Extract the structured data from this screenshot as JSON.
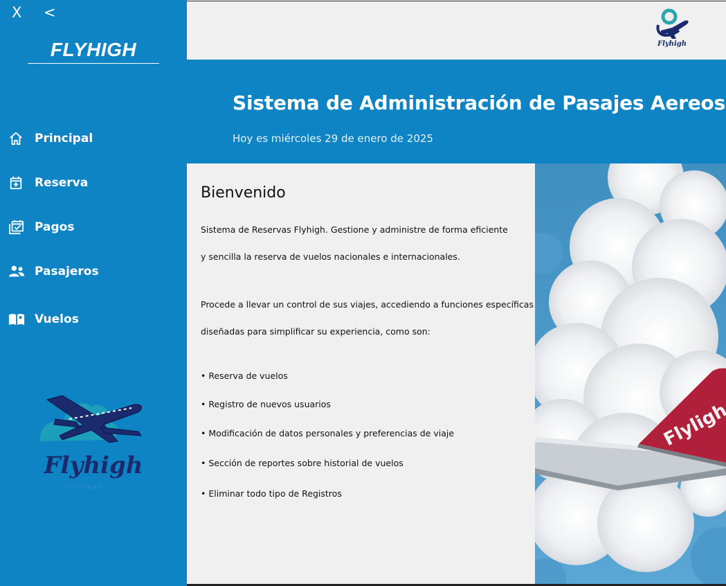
{
  "window": {
    "close_label": "X",
    "back_label": "<"
  },
  "sidebar": {
    "brand": "FLYHIGH",
    "items": [
      {
        "label": "Principal",
        "icon": "home-icon"
      },
      {
        "label": "Reserva",
        "icon": "calendar-plus-icon"
      },
      {
        "label": "Pagos",
        "icon": "calendar-check-icon"
      },
      {
        "label": "Pasajeros",
        "icon": "people-icon"
      },
      {
        "label": "Vuelos",
        "icon": "book-open-icon"
      }
    ],
    "logo": {
      "name": "Flyhigh",
      "tagline": "COMPANY"
    }
  },
  "header": {
    "logo_text": "Flyhigh",
    "title": "Sistema de Administración de Pasajes Aereos",
    "date": "Hoy es miércoles 29 de enero de 2025"
  },
  "main": {
    "welcome": "Bienvenido",
    "paragraphs": [
      "Sistema de Reservas Flyhigh. Gestione y administre de forma eficiente",
      " y sencilla la reserva de vuelos nacionales e internacionales.",
      "Procede a llevar un control de sus viajes, accediendo a funciones específicas",
      "diseñadas para simplificar su experiencia, como son:"
    ],
    "features": [
      "• Reserva de vuelos",
      "• Registro de nuevos usuarios",
      "• Modificación de datos personales y preferencias de viaje",
      "• Sección de reportes sobre historial de vuelos",
      "• Eliminar todo tipo de Registros"
    ],
    "photo_tail_text": "Flyligh"
  },
  "colors": {
    "primary": "#0f84c4",
    "logo_navy": "#1a2a6c",
    "logo_teal": "#2aa6b0",
    "tail_red": "#b0203a"
  }
}
